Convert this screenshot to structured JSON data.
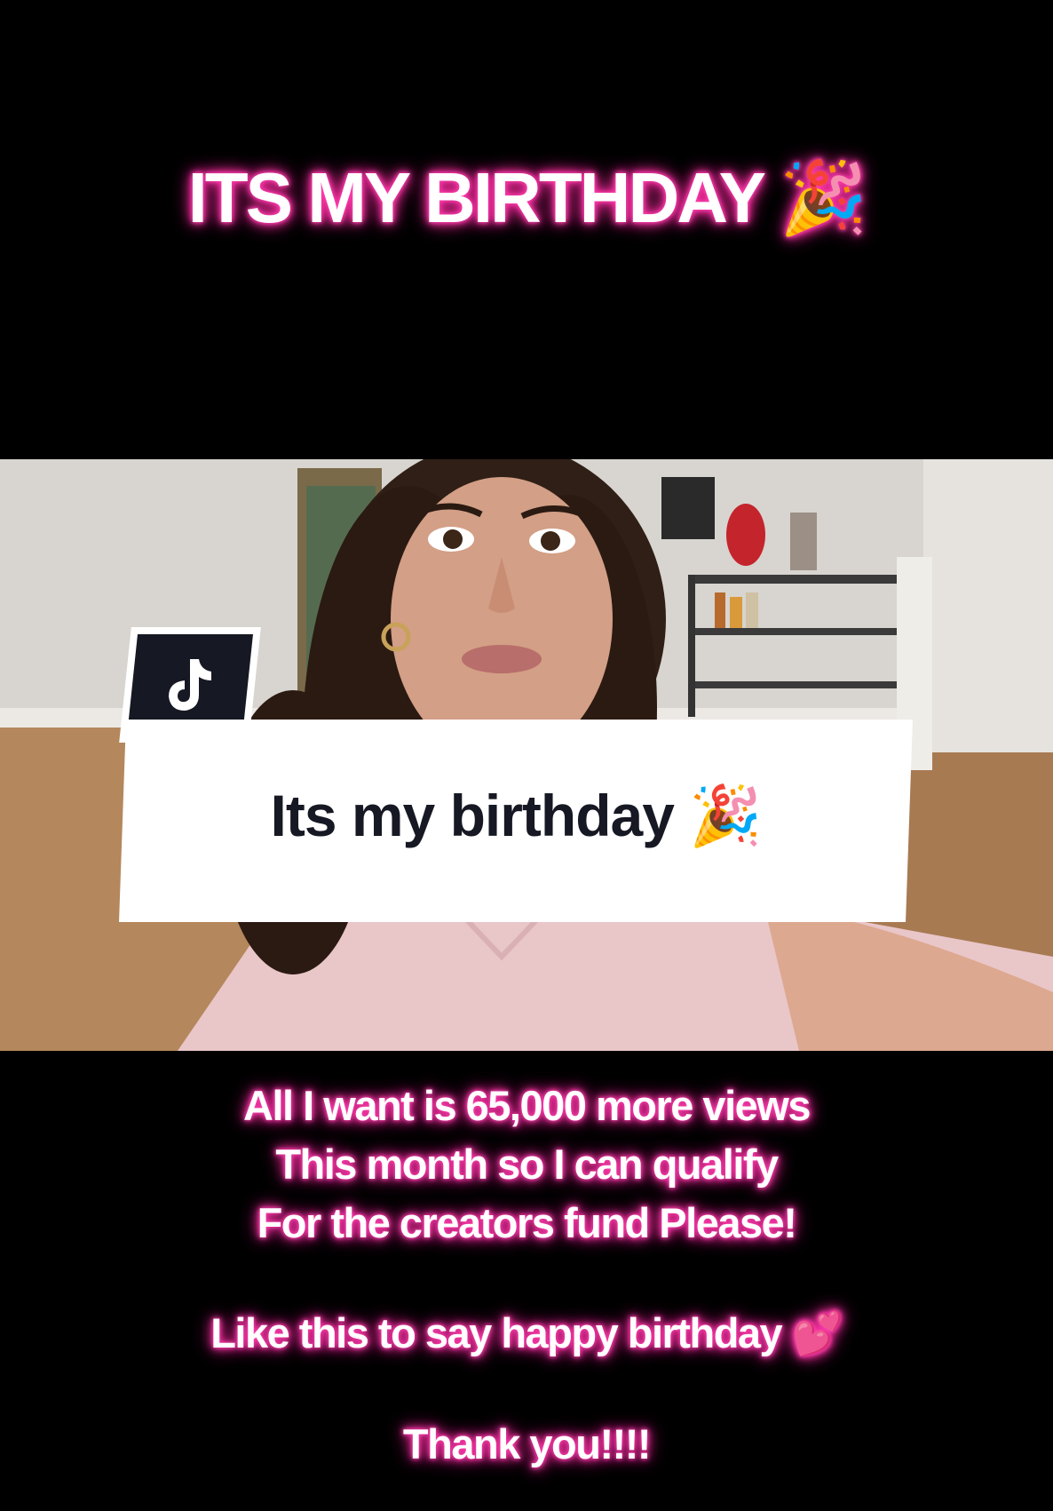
{
  "headline": {
    "text": "ITS MY BIRTHDAY",
    "emoji": "🎉"
  },
  "video": {
    "logo_icon": "tiktok-logo-icon",
    "caption_text": "Its my birthday",
    "caption_emoji": "🎉"
  },
  "message": {
    "line1": "All I want is 65,000 more views",
    "line2": "This month so I can qualify",
    "line3": "For the creators fund Please!",
    "line4": "Like this to say happy birthday",
    "line4_emoji": "💕",
    "line5": "Thank you!!!!"
  },
  "colors": {
    "background": "#000000",
    "glow": "#ff3fae",
    "caption_text": "#161823",
    "badge": "#161823"
  }
}
